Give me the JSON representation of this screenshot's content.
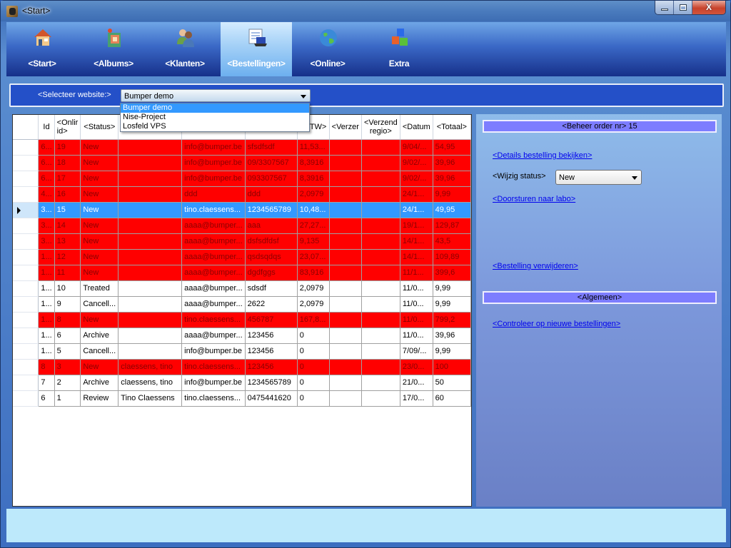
{
  "window": {
    "title": "<Start>",
    "controls": {
      "minimize": "minimize",
      "maximize": "maximize",
      "close": "X"
    }
  },
  "ribbon": {
    "tabs": [
      {
        "label": "<Start>",
        "icon": "house-icon"
      },
      {
        "label": "<Albums>",
        "icon": "photo-album-icon"
      },
      {
        "label": "<Klanten>",
        "icon": "users-icon"
      },
      {
        "label": "<Bestellingen>",
        "icon": "orders-laptop-icon",
        "active": true
      },
      {
        "label": "<Online>",
        "icon": "globe-icon"
      },
      {
        "label": "Extra",
        "icon": "cubes-icon"
      }
    ]
  },
  "website_selector": {
    "label": "<Selecteer website:>",
    "selected": "Bumper demo",
    "options": [
      "Bumper demo",
      "Nise-Project",
      "Losfeld VPS"
    ]
  },
  "grid": {
    "columns": [
      "Id",
      "<Onlir id>",
      "<Status>",
      "",
      "",
      "",
      "<BTW>",
      "<Verzer",
      "<Verzend regio>",
      "<Datum",
      "<Totaal>"
    ],
    "column_header_lines": {
      "online_id": [
        "<Onlir",
        "id>"
      ],
      "verzend_regio": [
        "<Verzend",
        "regio>"
      ]
    },
    "rows": [
      {
        "id": "6...",
        "online_id": "19",
        "status": "New",
        "name": "",
        "email": "info@bumper.be",
        "phone": "sfsdfsdf",
        "btw": "11,53...",
        "verzen": "",
        "regio": "",
        "datum": "9/04/...",
        "totaal": "54,95",
        "highlight": "red"
      },
      {
        "id": "6...",
        "online_id": "18",
        "status": "New",
        "name": "",
        "email": "info@bumper.be",
        "phone": "09/3307567",
        "btw": "8,3916",
        "verzen": "",
        "regio": "",
        "datum": "9/02/...",
        "totaal": "39,96",
        "highlight": "red"
      },
      {
        "id": "6...",
        "online_id": "17",
        "status": "New",
        "name": "",
        "email": "info@bumper.be",
        "phone": "093307567",
        "btw": "8,3916",
        "verzen": "",
        "regio": "",
        "datum": "9/02/...",
        "totaal": "39,96",
        "highlight": "red"
      },
      {
        "id": "4...",
        "online_id": "16",
        "status": "New",
        "name": "",
        "email": "ddd",
        "phone": "ddd",
        "btw": "2,0979",
        "verzen": "",
        "regio": "",
        "datum": "24/1...",
        "totaal": "9,99",
        "highlight": "red"
      },
      {
        "id": "3...",
        "online_id": "15",
        "status": "New",
        "name": "",
        "email": "tino.claessens...",
        "phone": "1234565789",
        "btw": "10,48...",
        "verzen": "",
        "regio": "",
        "datum": "24/1...",
        "totaal": "49,95",
        "highlight": "selected"
      },
      {
        "id": "3...",
        "online_id": "14",
        "status": "New",
        "name": "",
        "email": "aaaa@bumper...",
        "phone": "aaa",
        "btw": "27,27...",
        "verzen": "",
        "regio": "",
        "datum": "19/1...",
        "totaal": "129,87",
        "highlight": "red"
      },
      {
        "id": "3...",
        "online_id": "13",
        "status": "New",
        "name": "",
        "email": "aaaa@bumper...",
        "phone": "dsfsdfdsf",
        "btw": "9,135",
        "verzen": "",
        "regio": "",
        "datum": "14/1...",
        "totaal": "43,5",
        "highlight": "red"
      },
      {
        "id": "1...",
        "online_id": "12",
        "status": "New",
        "name": "",
        "email": "aaaa@bumper...",
        "phone": "qsdsqdqs",
        "btw": "23,07...",
        "verzen": "",
        "regio": "",
        "datum": "14/1...",
        "totaal": "109,89",
        "highlight": "red"
      },
      {
        "id": "1...",
        "online_id": "11",
        "status": "New",
        "name": "",
        "email": "aaaa@bumper...",
        "phone": "dgdfggs",
        "btw": "83,916",
        "verzen": "",
        "regio": "",
        "datum": "11/1...",
        "totaal": "399,6",
        "highlight": "red"
      },
      {
        "id": "1...",
        "online_id": "10",
        "status": "Treated",
        "name": "",
        "email": "aaaa@bumper...",
        "phone": "sdsdf",
        "btw": "2,0979",
        "verzen": "",
        "regio": "",
        "datum": "11/0...",
        "totaal": "9,99",
        "highlight": "none"
      },
      {
        "id": "1...",
        "online_id": "9",
        "status": "Cancell...",
        "name": "",
        "email": "aaaa@bumper...",
        "phone": "2622",
        "btw": "2,0979",
        "verzen": "",
        "regio": "",
        "datum": "11/0...",
        "totaal": "9,99",
        "highlight": "none"
      },
      {
        "id": "1...",
        "online_id": "8",
        "status": "New",
        "name": "",
        "email": "tino.claessens...",
        "phone": "456787",
        "btw": "167,8...",
        "verzen": "",
        "regio": "",
        "datum": "11/0...",
        "totaal": "799,2",
        "highlight": "red"
      },
      {
        "id": "1...",
        "online_id": "6",
        "status": "Archive",
        "name": "",
        "email": "aaaa@bumper...",
        "phone": "123456",
        "btw": "0",
        "verzen": "",
        "regio": "",
        "datum": "11/0...",
        "totaal": "39,96",
        "highlight": "none"
      },
      {
        "id": "1...",
        "online_id": "5",
        "status": "Cancell...",
        "name": "",
        "email": "info@bumper.be",
        "phone": "123456",
        "btw": "0",
        "verzen": "",
        "regio": "",
        "datum": "7/09/...",
        "totaal": "9,99",
        "highlight": "none"
      },
      {
        "id": "8",
        "online_id": "3",
        "status": "New",
        "name": "claessens, tino",
        "email": "tino.claessens...",
        "phone": "123456",
        "btw": "0",
        "verzen": "",
        "regio": "",
        "datum": "23/0...",
        "totaal": "100",
        "highlight": "red"
      },
      {
        "id": "7",
        "online_id": "2",
        "status": "Archive",
        "name": "claessens, tino",
        "email": "info@bumper.be",
        "phone": "1234565789",
        "btw": "0",
        "verzen": "",
        "regio": "",
        "datum": "21/0...",
        "totaal": "50",
        "highlight": "none"
      },
      {
        "id": "6",
        "online_id": "1",
        "status": "Review",
        "name": "Tino Claessens",
        "email": "tino.claessens...",
        "phone": "0475441620",
        "btw": "0",
        "verzen": "",
        "regio": "",
        "datum": "17/0...",
        "totaal": "60",
        "highlight": "none"
      }
    ]
  },
  "side_panel": {
    "order_header": "<Beheer order nr> 15",
    "details_link": "<Details bestelling bekijken>",
    "change_status_label": "<Wijzig status>",
    "status_value": "New",
    "forward_link": "<Doorsturen naar labo>",
    "delete_link": "<Bestelling verwijderen>",
    "general_header": "<Algemeen>",
    "check_new_link": "<Controleer op nieuwe bestellingen>"
  },
  "colors": {
    "new_row": "#ff0000",
    "selected_row": "#3399ff",
    "section_header": "#7d7dff",
    "link": "#0000ee"
  }
}
